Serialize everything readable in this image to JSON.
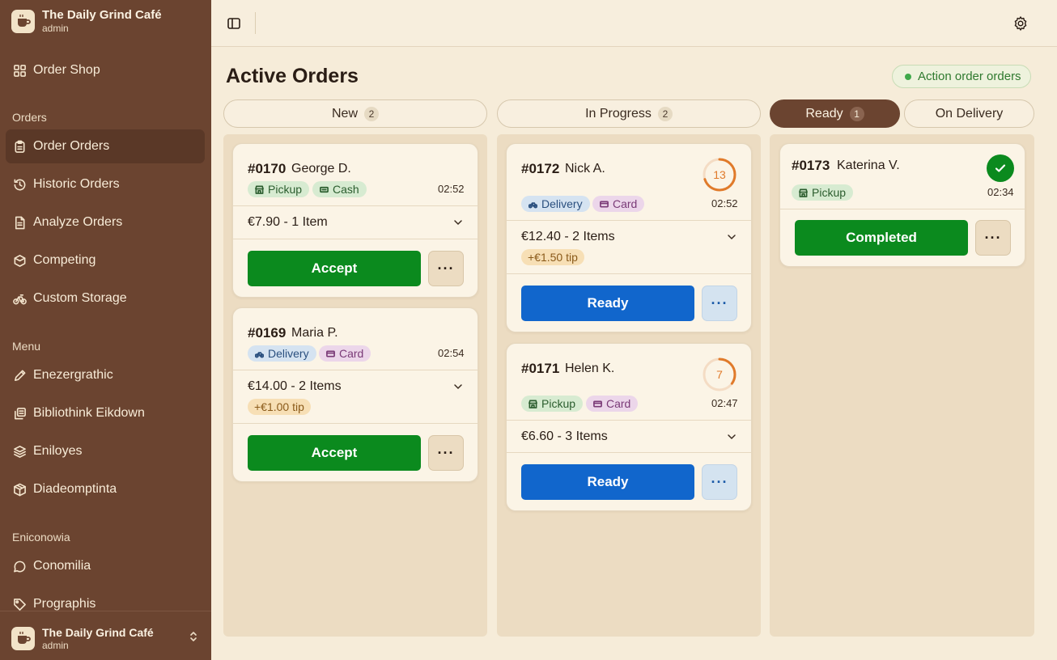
{
  "app": {
    "name": "The Daily Grind Café",
    "role": "admin"
  },
  "sidebar": {
    "top_item": {
      "label": "Order Shop",
      "icon": "grid-icon"
    },
    "sections": [
      {
        "title": "Orders",
        "items": [
          {
            "label": "Order Orders",
            "icon": "clipboard-icon",
            "active": true
          },
          {
            "label": "Historic Orders",
            "icon": "history-icon"
          },
          {
            "label": "Analyze Orders",
            "icon": "document-icon"
          },
          {
            "label": "Competing",
            "icon": "hexagon-icon"
          },
          {
            "label": "Custom Storage",
            "icon": "bike-icon"
          }
        ]
      },
      {
        "title": "Menu",
        "items": [
          {
            "label": "Enezergrathic",
            "icon": "pencil-icon"
          },
          {
            "label": "Bibliothink Eikdown",
            "icon": "copy-icon"
          },
          {
            "label": "Eniloyes",
            "icon": "layers-icon"
          },
          {
            "label": "Diadeomptinta",
            "icon": "package-icon"
          }
        ]
      },
      {
        "title": "Eniconowia",
        "items": [
          {
            "label": "Conomilia",
            "icon": "chat-icon"
          },
          {
            "label": "Prographis",
            "icon": "tag-icon"
          }
        ]
      }
    ],
    "footer": {
      "name": "The Daily Grind Café",
      "role": "admin"
    }
  },
  "main": {
    "title": "Active Orders",
    "status_label": "Action order orders",
    "status_color": "#3fa94b",
    "tabs": [
      {
        "label": "New",
        "count": "2"
      },
      {
        "label": "In Progress",
        "count": "2"
      },
      {
        "label": "Ready",
        "count": "1",
        "active": true
      },
      {
        "label": "On Delivery"
      }
    ]
  },
  "orders": {
    "o170": {
      "id": "#0170",
      "customer": "George D.",
      "type": "Pickup",
      "payment": "Cash",
      "time": "02:52",
      "summary": "€7.90 - 1 Item",
      "action": "Accept",
      "more": "···"
    },
    "o169": {
      "id": "#0169",
      "customer": "Maria P.",
      "type": "Delivery",
      "payment": "Card",
      "time": "02:54",
      "summary": "€14.00 - 2 Items",
      "tip": "+€1.00 tip",
      "action": "Accept",
      "more": "···"
    },
    "o172": {
      "id": "#0172",
      "customer": "Nick A.",
      "type": "Delivery",
      "payment": "Card",
      "time": "02:52",
      "timer": "13",
      "timer_progress": 0.7,
      "summary": "€12.40 - 2 Items",
      "tip": "+€1.50 tip",
      "action": "Ready",
      "more": "···"
    },
    "o171": {
      "id": "#0171",
      "customer": "Helen K.",
      "type": "Pickup",
      "payment": "Card",
      "time": "02:47",
      "timer": "7",
      "timer_progress": 0.35,
      "summary": "€6.60 - 3 Items",
      "action": "Ready",
      "more": "···"
    },
    "o173": {
      "id": "#0173",
      "customer": "Katerina V.",
      "type": "Pickup",
      "time": "02:34",
      "action": "Completed",
      "more": "···"
    }
  },
  "colors": {
    "sidebar": "#6b4430",
    "accept": "#0b8a1e",
    "ready": "#1166cc",
    "timer": "#e07a2a"
  }
}
